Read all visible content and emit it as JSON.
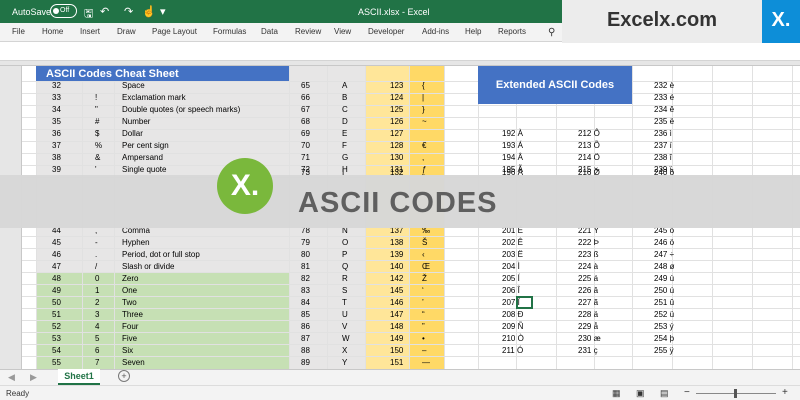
{
  "titlebar": {
    "autosave_label": "AutoSave",
    "toggle_state": "Off",
    "doc_title": "ASCII.xlsx - Excel"
  },
  "ribbon_tabs": [
    "File",
    "Home",
    "Insert",
    "Draw",
    "Page Layout",
    "Formulas",
    "Data",
    "Review",
    "View",
    "Developer",
    "Add-ins",
    "Help",
    "Reports"
  ],
  "brand": {
    "name": "Excelx.com",
    "mark": "X."
  },
  "sheet": {
    "cheat_title": "ASCII Codes Cheat Sheet",
    "extended_title": "Extended ASCII Codes",
    "top_rows": [
      {
        "code": "32",
        "char": "",
        "name": "Space",
        "c2": "65",
        "ch2": "A",
        "c3": "123",
        "ch3": "{",
        "ext": []
      },
      {
        "code": "33",
        "char": "!",
        "name": "Exclamation mark",
        "c2": "66",
        "ch2": "B",
        "c3": "124",
        "ch3": "|",
        "ext": []
      },
      {
        "code": "34",
        "char": "\"",
        "name": "Double quotes (or speech marks)",
        "c2": "67",
        "ch2": "C",
        "c3": "125",
        "ch3": "}",
        "ext": []
      },
      {
        "code": "35",
        "char": "#",
        "name": "Number",
        "c2": "68",
        "ch2": "D",
        "c3": "126",
        "ch3": "~",
        "ext": []
      },
      {
        "code": "36",
        "char": "$",
        "name": "Dollar",
        "c2": "69",
        "ch2": "E",
        "c3": "127",
        "ch3": "",
        "ext": [
          "192 À",
          "212 Ô"
        ]
      },
      {
        "code": "37",
        "char": "%",
        "name": "Per cent sign",
        "c2": "70",
        "ch2": "F",
        "c3": "128",
        "ch3": "€",
        "ext": [
          "193 Á",
          "213 Õ"
        ]
      },
      {
        "code": "38",
        "char": "&",
        "name": "Ampersand",
        "c2": "71",
        "ch2": "G",
        "c3": "130",
        "ch3": ",",
        "ext": [
          "194 Â",
          "214 Ö"
        ]
      },
      {
        "code": "39",
        "char": "'",
        "name": "Single quote",
        "c2": "72",
        "ch2": "H",
        "c3": "131",
        "ch3": "ƒ",
        "ext": [
          "195 Ã",
          "215 ×"
        ]
      },
      {
        "code": "",
        "char": "",
        "name": "",
        "c2": "73",
        "ch2": "I",
        "c3": "132",
        "ch3": "„",
        "ext": [
          "196 Ä",
          "216 Ø"
        ]
      }
    ],
    "right_col_top": [
      "232 è",
      "233 é",
      "234 ê",
      "235 ë",
      "236 ì",
      "237 í",
      "238 î",
      "239 ï",
      "240 ð"
    ],
    "bottom_rows": [
      {
        "code": "44",
        "char": ",",
        "name": "Comma",
        "c2": "78",
        "ch2": "N",
        "c3": "137",
        "ch3": "‰",
        "e1": "201 É",
        "e2": "221 Ý",
        "e3": "245 õ"
      },
      {
        "code": "45",
        "char": "-",
        "name": "Hyphen",
        "c2": "79",
        "ch2": "O",
        "c3": "138",
        "ch3": "Š",
        "e1": "202 Ê",
        "e2": "222 Þ",
        "e3": "246 ö"
      },
      {
        "code": "46",
        "char": ".",
        "name": "Period, dot or full stop",
        "c2": "80",
        "ch2": "P",
        "c3": "139",
        "ch3": "‹",
        "e1": "203 Ë",
        "e2": "223 ß",
        "e3": "247 ÷"
      },
      {
        "code": "47",
        "char": "/",
        "name": "Slash or divide",
        "c2": "81",
        "ch2": "Q",
        "c3": "140",
        "ch3": "Œ",
        "e1": "204 Ì",
        "e2": "224 à",
        "e3": "248 ø"
      },
      {
        "code": "48",
        "char": "0",
        "name": "Zero",
        "c2": "82",
        "ch2": "R",
        "c3": "142",
        "ch3": "Ž",
        "e1": "205 Í",
        "e2": "225 á",
        "e3": "249 ù"
      },
      {
        "code": "49",
        "char": "1",
        "name": "One",
        "c2": "83",
        "ch2": "S",
        "c3": "145",
        "ch3": "‘",
        "e1": "206 Î",
        "e2": "226 â",
        "e3": "250 ú"
      },
      {
        "code": "50",
        "char": "2",
        "name": "Two",
        "c2": "84",
        "ch2": "T",
        "c3": "146",
        "ch3": "’",
        "e1": "207 Ï",
        "e2": "227 ã",
        "e3": "251 û"
      },
      {
        "code": "51",
        "char": "3",
        "name": "Three",
        "c2": "85",
        "ch2": "U",
        "c3": "147",
        "ch3": "“",
        "e1": "208 Ð",
        "e2": "228 ä",
        "e3": "252 ü"
      },
      {
        "code": "52",
        "char": "4",
        "name": "Four",
        "c2": "86",
        "ch2": "V",
        "c3": "148",
        "ch3": "”",
        "e1": "209 Ñ",
        "e2": "229 å",
        "e3": "253 ý"
      },
      {
        "code": "53",
        "char": "5",
        "name": "Five",
        "c2": "87",
        "ch2": "W",
        "c3": "149",
        "ch3": "•",
        "e1": "210 Ò",
        "e2": "230 æ",
        "e3": "254 þ"
      },
      {
        "code": "54",
        "char": "6",
        "name": "Six",
        "c2": "88",
        "ch2": "X",
        "c3": "150",
        "ch3": "–",
        "e1": "211 Ó",
        "e2": "231 ç",
        "e3": "255 ÿ"
      },
      {
        "code": "55",
        "char": "7",
        "name": "Seven",
        "c2": "89",
        "ch2": "Y",
        "c3": "151",
        "ch3": "—",
        "e1": "",
        "e2": "",
        "e3": ""
      }
    ]
  },
  "overlay": {
    "badge": "X.",
    "text": "ASCII CODES"
  },
  "sheet_tab": "Sheet1",
  "add_sheet": "+",
  "status": "Ready",
  "colors": {
    "excel_green": "#217346",
    "header_blue": "#4472c4",
    "grey_fill": "#e7e6e6",
    "green_fill": "#c6e0b4",
    "yellow_fill": "#ffe699",
    "orange_fill": "#ffd966",
    "brand_blue": "#0d8ed8",
    "badge_green": "#7ab83c"
  }
}
